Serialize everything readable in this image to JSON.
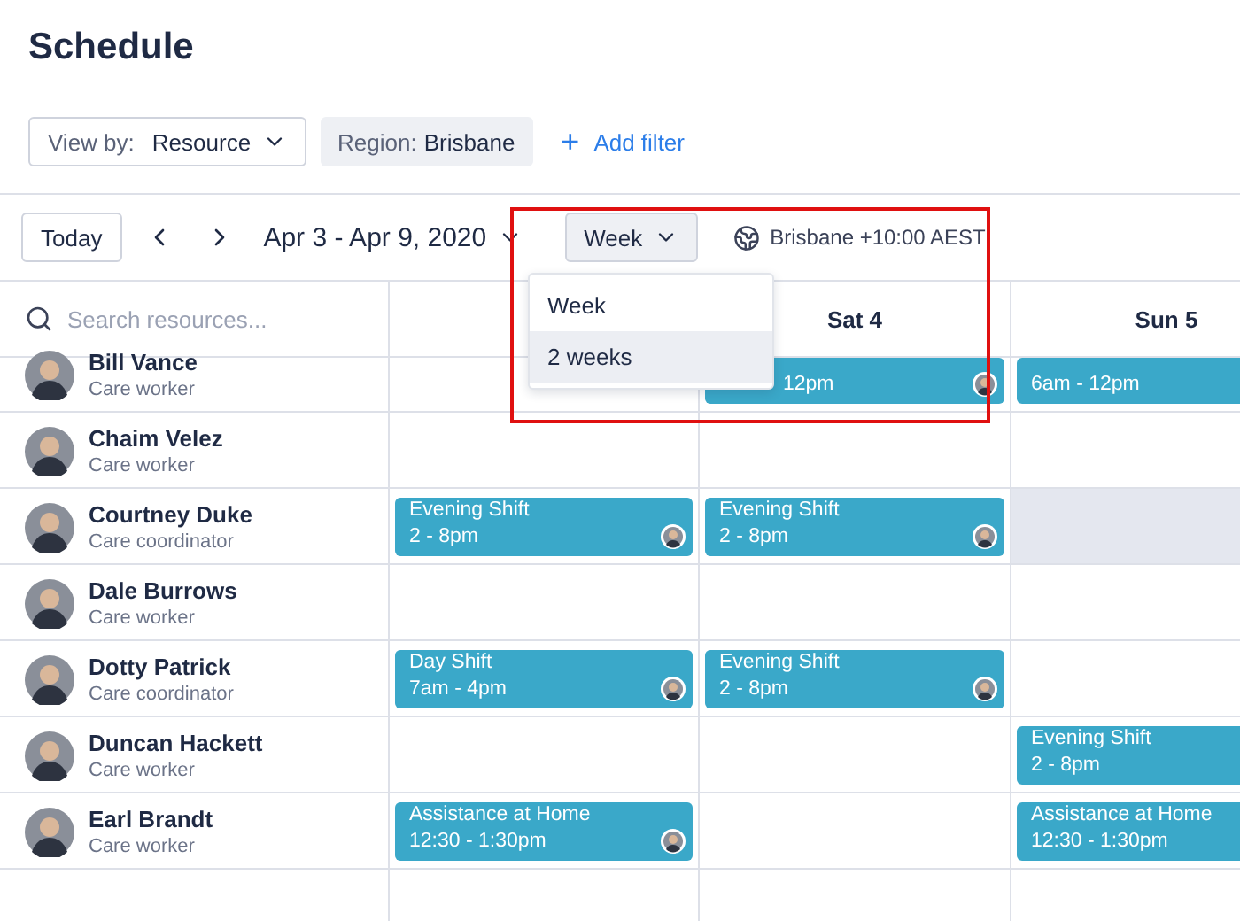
{
  "title": "Schedule",
  "filters": {
    "view_by": {
      "label": "View by:",
      "value": "Resource"
    },
    "region": {
      "label": "Region:",
      "value": "Brisbane"
    },
    "add_filter": {
      "icon": "+",
      "label": "Add filter"
    }
  },
  "toolbar": {
    "today": "Today",
    "range": "Apr 3 - Apr 9, 2020",
    "period": "Week",
    "timezone": "Brisbane +10:00 AEST"
  },
  "period_menu": [
    {
      "label": "Week",
      "selected": false
    },
    {
      "label": "2 weeks",
      "selected": true
    }
  ],
  "search": {
    "placeholder": "Search resources..."
  },
  "days": [
    {
      "label": "Sat 4"
    },
    {
      "label": "Sun 5"
    }
  ],
  "resources": [
    {
      "name": "Bill Vance",
      "role": "Care worker",
      "cells": [
        {
          "kind": "empty"
        },
        {
          "kind": "shift",
          "shift": {
            "time": "12pm",
            "avatar": true,
            "under_menu": true
          }
        },
        {
          "kind": "shift",
          "shift": {
            "time": "6am - 12pm",
            "under_menu": false
          }
        }
      ]
    },
    {
      "name": "Chaim Velez",
      "role": "Care worker",
      "cells": [
        {
          "kind": "empty"
        },
        {
          "kind": "empty"
        },
        {
          "kind": "empty"
        }
      ]
    },
    {
      "name": "Courtney Duke",
      "role": "Care coordinator",
      "cells": [
        {
          "kind": "shift",
          "shift": {
            "title": "Evening Shift",
            "time": "2 - 8pm",
            "avatar": true,
            "under_menu": false
          }
        },
        {
          "kind": "shift",
          "shift": {
            "title": "Evening Shift",
            "time": "2 - 8pm",
            "avatar": true,
            "under_menu": false
          }
        },
        {
          "kind": "unavailable"
        }
      ]
    },
    {
      "name": "Dale Burrows",
      "role": "Care worker",
      "cells": [
        {
          "kind": "empty"
        },
        {
          "kind": "empty"
        },
        {
          "kind": "empty"
        }
      ]
    },
    {
      "name": "Dotty Patrick",
      "role": "Care coordinator",
      "cells": [
        {
          "kind": "shift",
          "shift": {
            "title": "Day Shift",
            "time": "7am - 4pm",
            "avatar": true,
            "under_menu": false
          }
        },
        {
          "kind": "shift",
          "shift": {
            "title": "Evening Shift",
            "time": "2 - 8pm",
            "avatar": true,
            "under_menu": false
          }
        },
        {
          "kind": "empty"
        }
      ]
    },
    {
      "name": "Duncan Hackett",
      "role": "Care worker",
      "cells": [
        {
          "kind": "empty"
        },
        {
          "kind": "empty"
        },
        {
          "kind": "shift",
          "shift": {
            "title": "Evening Shift",
            "time": "2 - 8pm",
            "under_menu": false
          }
        }
      ]
    },
    {
      "name": "Earl Brandt",
      "role": "Care worker",
      "cells": [
        {
          "kind": "shift",
          "shift": {
            "title": "Assistance at Home",
            "time": "12:30 - 1:30pm",
            "avatar": true,
            "under_menu": false
          }
        },
        {
          "kind": "empty"
        },
        {
          "kind": "shift",
          "shift": {
            "title": "Assistance at Home",
            "time": "12:30 - 1:30pm",
            "under_menu": false
          }
        }
      ]
    }
  ]
}
